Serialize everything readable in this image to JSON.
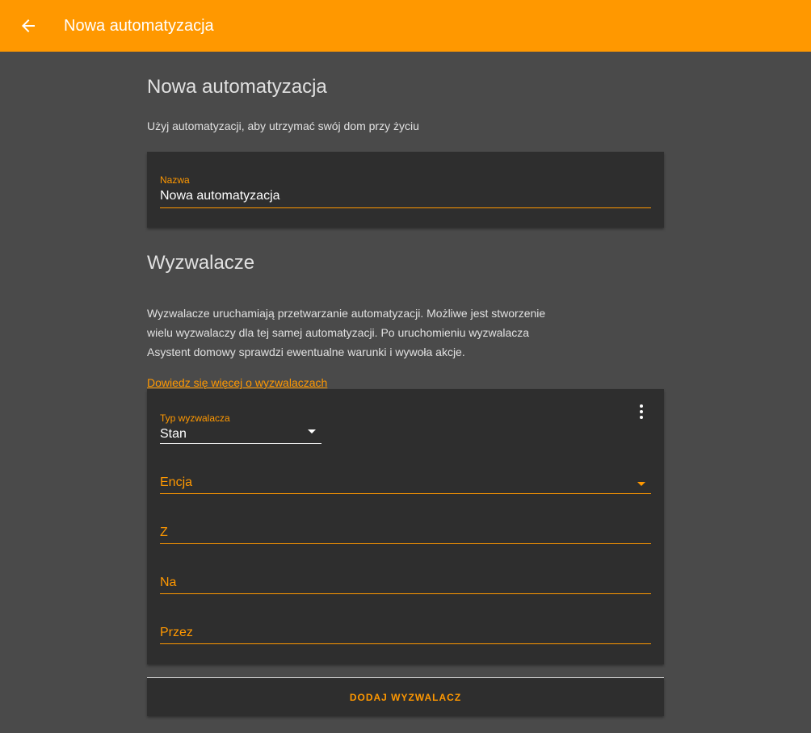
{
  "header": {
    "title": "Nowa automatyzacja",
    "back_icon": "arrow-left-icon",
    "bar_color": "#ff9800"
  },
  "intro": {
    "title": "Nowa automatyzacja",
    "description": "Użyj automatyzacji, aby utrzymać swój dom przy życiu"
  },
  "name_field": {
    "label": "Nazwa",
    "value": "Nowa automatyzacja"
  },
  "triggers": {
    "title": "Wyzwalacze",
    "description": "Wyzwalacze uruchamiają przetwarzanie automatyzacji. Możliwe jest stworzenie wielu wyzwalaczy dla tej samej automatyzacji. Po uruchomieniu wyzwalacza Asystent domowy sprawdzi ewentualne warunki i wywoła akcje.",
    "learn_more": "Dowiedz się więcej o wyzwalaczach",
    "card": {
      "menu_icon": "dots-vertical-icon",
      "type_label": "Typ wyzwalacza",
      "type_value": "Stan",
      "entity_label": "Encja",
      "from_label": "Z",
      "to_label": "Na",
      "for_label": "Przez"
    },
    "add_button": "DODAJ WYZWALACZ"
  },
  "colors": {
    "accent": "#ff9800",
    "background": "#4a4a4a",
    "card": "#2e2e2e"
  }
}
